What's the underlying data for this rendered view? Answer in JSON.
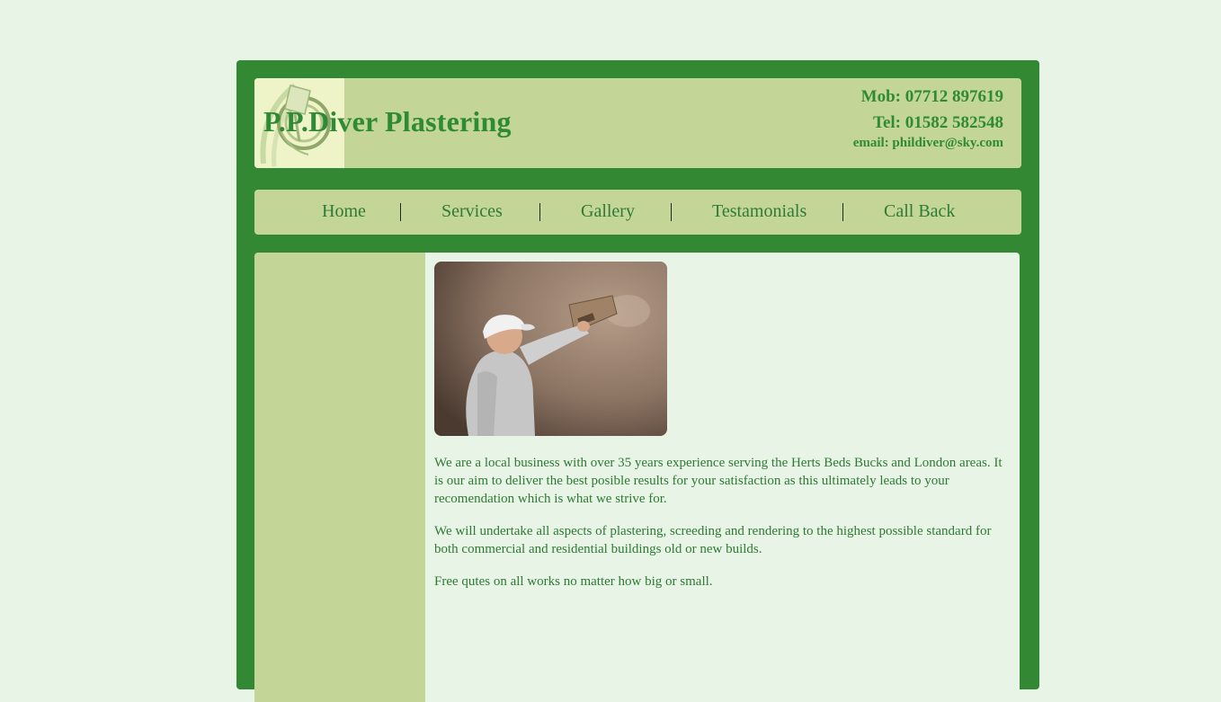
{
  "header": {
    "brand": "P.P.Diver Plastering",
    "mob": "Mob: 07712 897619",
    "tel": "Tel: 01582 582548",
    "email": "email: phildiver@sky.com"
  },
  "nav": {
    "items": [
      {
        "label": "Home"
      },
      {
        "label": "Services"
      },
      {
        "label": "Gallery"
      },
      {
        "label": "Testamonials"
      },
      {
        "label": "Call Back"
      }
    ]
  },
  "main": {
    "paragraphs": [
      "We are a local business with over 35 years experience serving the Herts Beds Bucks and London areas. It is our aim to deliver the best posible results for your satisfaction as this ultimately leads to your recomendation which is what we strive for.",
      "We will undertake all aspects of plastering, screeding and rendering to the highest possible standard for both commercial and residential buildings old or new builds.",
      "Free qutes on all works no matter how big or small."
    ]
  },
  "colors": {
    "outer_green": "#338833",
    "panel_green": "#c3d698",
    "page_bg": "#e7f4e6",
    "text_green": "#2f7a34"
  },
  "icons": {
    "logo": "trowel-logo-icon"
  }
}
